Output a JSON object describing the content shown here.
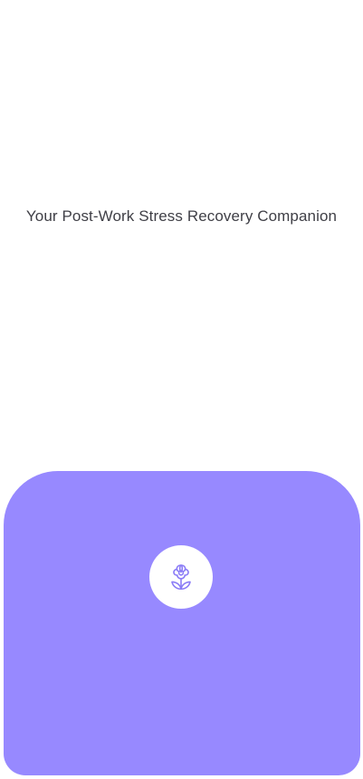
{
  "welcome": {
    "tagline": "Your Post-Work Stress Recovery Companion"
  },
  "card": {
    "background_color": "#9789ff",
    "icon": "flower-icon",
    "icon_color": "#8b7cf6"
  }
}
